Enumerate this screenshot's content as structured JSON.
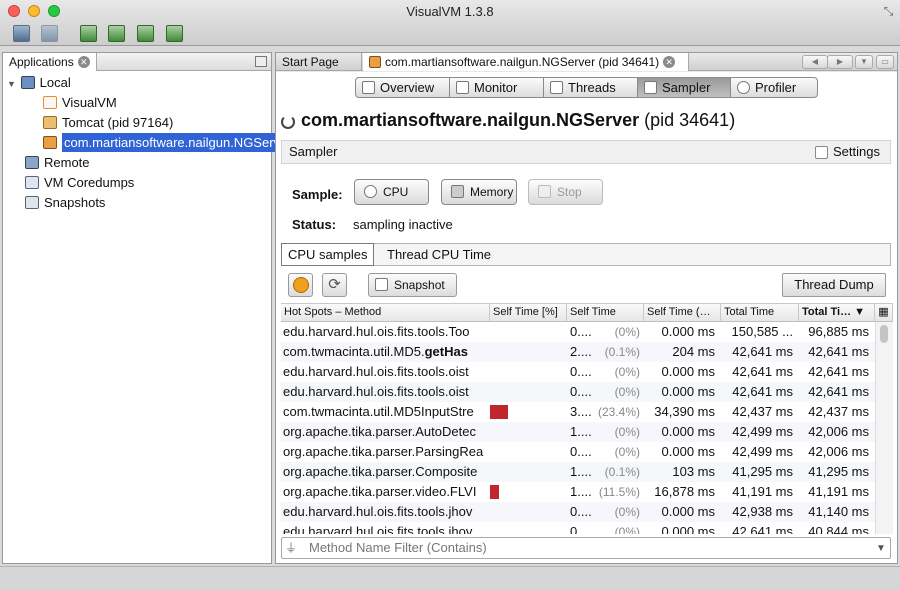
{
  "window": {
    "title": "VisualVM 1.3.8"
  },
  "applications_panel": {
    "tab_label": "Applications",
    "tree": [
      {
        "label": "Local",
        "icon": "computer-icon",
        "level": 0,
        "expanded": true
      },
      {
        "label": "VisualVM",
        "icon": "visualvm-app-icon",
        "level": 1
      },
      {
        "label": "Tomcat (pid 97164)",
        "icon": "tomcat-icon",
        "level": 1
      },
      {
        "label": "com.martiansoftware.nailgun.NGServer",
        "icon": "java-app-icon",
        "level": 1,
        "selected": true
      },
      {
        "label": "Remote",
        "icon": "remote-host-icon",
        "level": 0
      },
      {
        "label": "VM Coredumps",
        "icon": "coredump-icon",
        "level": 0
      },
      {
        "label": "Snapshots",
        "icon": "snapshots-icon",
        "level": 0
      }
    ]
  },
  "document_tabs": [
    {
      "label": "Start Page"
    },
    {
      "label": "com.martiansoftware.nailgun.NGServer (pid 34641)",
      "active": true
    }
  ],
  "view_tabs": [
    {
      "label": "Overview",
      "icon": "overview-icon"
    },
    {
      "label": "Monitor",
      "icon": "monitor-icon"
    },
    {
      "label": "Threads",
      "icon": "threads-icon"
    },
    {
      "label": "Sampler",
      "icon": "sampler-icon",
      "active": true
    },
    {
      "label": "Profiler",
      "icon": "profiler-icon"
    }
  ],
  "header": {
    "app_name": "com.martiansoftware.nailgun.NGServer",
    "pid": "(pid 34641)"
  },
  "sampler": {
    "section_label": "Sampler",
    "settings_label": "Settings",
    "sample_label": "Sample:",
    "cpu_label": "CPU",
    "memory_label": "Memory",
    "stop_label": "Stop",
    "status_label": "Status:",
    "status_value": "sampling inactive",
    "subtabs": [
      "CPU samples",
      "Thread CPU Time"
    ],
    "snapshot_label": "Snapshot",
    "thread_dump_label": "Thread Dump",
    "filter_placeholder": "Method Name Filter (Contains)"
  },
  "table": {
    "columns": [
      "Hot Spots – Method",
      "Self Time [%]",
      "Self Time",
      "Self Time (…",
      "Total Time",
      "Total Ti…"
    ],
    "rows": [
      {
        "method": "edu.harvard.hul.ois.fits.tools.Too",
        "self_pct": 0,
        "self_time_text": "0....",
        "pct_text": "(0%)",
        "self_cpu": "0.000 ms",
        "total_time": "150,585 ...",
        "total_cpu": "96,885 ms"
      },
      {
        "method": "com.twmacinta.util.MD5.",
        "method_bold": "getHas",
        "self_pct": 0.1,
        "self_time_text": "2....",
        "pct_text": "(0.1%)",
        "self_cpu": "204 ms",
        "total_time": "42,641 ms",
        "total_cpu": "42,641 ms"
      },
      {
        "method": "edu.harvard.hul.ois.fits.tools.oist",
        "self_pct": 0,
        "self_time_text": "0....",
        "pct_text": "(0%)",
        "self_cpu": "0.000 ms",
        "total_time": "42,641 ms",
        "total_cpu": "42,641 ms"
      },
      {
        "method": "edu.harvard.hul.ois.fits.tools.oist",
        "self_pct": 0,
        "self_time_text": "0....",
        "pct_text": "(0%)",
        "self_cpu": "0.000 ms",
        "total_time": "42,641 ms",
        "total_cpu": "42,641 ms"
      },
      {
        "method": "com.twmacinta.util.MD5InputStre",
        "self_pct": 23.4,
        "self_time_text": "3....",
        "pct_text": "(23.4%)",
        "self_cpu": "34,390 ms",
        "total_time": "42,437 ms",
        "total_cpu": "42,437 ms"
      },
      {
        "method": "org.apache.tika.parser.AutoDetec",
        "self_pct": 0,
        "self_time_text": "1....",
        "pct_text": "(0%)",
        "self_cpu": "0.000 ms",
        "total_time": "42,499 ms",
        "total_cpu": "42,006 ms"
      },
      {
        "method": "org.apache.tika.parser.ParsingRea",
        "self_pct": 0,
        "self_time_text": "0....",
        "pct_text": "(0%)",
        "self_cpu": "0.000 ms",
        "total_time": "42,499 ms",
        "total_cpu": "42,006 ms"
      },
      {
        "method": "org.apache.tika.parser.Composite",
        "self_pct": 0.1,
        "self_time_text": "1....",
        "pct_text": "(0.1%)",
        "self_cpu": "103 ms",
        "total_time": "41,295 ms",
        "total_cpu": "41,295 ms"
      },
      {
        "method": "org.apache.tika.parser.video.FLVI",
        "self_pct": 11.5,
        "self_time_text": "1....",
        "pct_text": "(11.5%)",
        "self_cpu": "16,878 ms",
        "total_time": "41,191 ms",
        "total_cpu": "41,191 ms"
      },
      {
        "method": "edu.harvard.hul.ois.fits.tools.jhov",
        "self_pct": 0,
        "self_time_text": "0....",
        "pct_text": "(0%)",
        "self_cpu": "0.000 ms",
        "total_time": "42,938 ms",
        "total_cpu": "41,140 ms"
      },
      {
        "method": "edu.harvard.hul.ois.fits.tools.jhov",
        "self_pct": 0,
        "self_time_text": "0....",
        "pct_text": "(0%)",
        "self_cpu": "0.000 ms",
        "total_time": "42,641 ms",
        "total_cpu": "40,844 ms"
      }
    ]
  },
  "colors": {
    "selection": "#2f63d6",
    "bar": "#c0272d"
  }
}
